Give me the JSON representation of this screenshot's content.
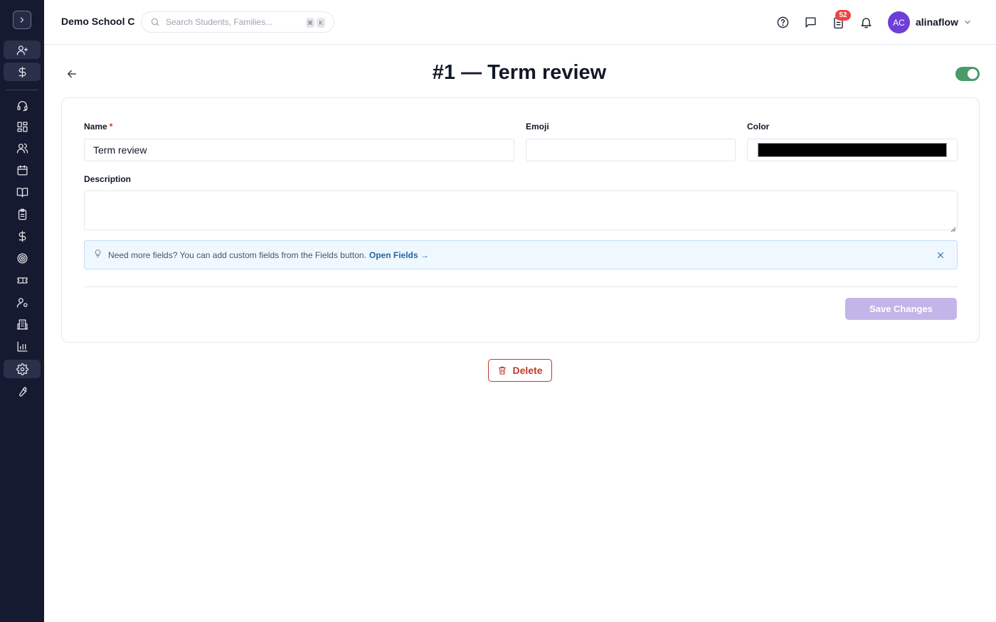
{
  "header": {
    "school_name": "Demo School C",
    "search_placeholder": "Search Students, Families...",
    "shortcut_keys": [
      "⌘",
      "K"
    ],
    "notification_count": "52",
    "user": {
      "initials": "AC",
      "name": "alinaflow",
      "avatar_color": "#6d3fd6"
    }
  },
  "sidebar": {
    "items": [
      {
        "icon": "user-plus-icon"
      },
      {
        "icon": "dollar-icon"
      },
      {
        "icon": "headset-icon"
      },
      {
        "icon": "dashboard-icon"
      },
      {
        "icon": "users-icon"
      },
      {
        "icon": "calendar-icon"
      },
      {
        "icon": "book-open-icon"
      },
      {
        "icon": "clipboard-icon"
      },
      {
        "icon": "dollar-icon"
      },
      {
        "icon": "target-icon"
      },
      {
        "icon": "ticket-icon"
      },
      {
        "icon": "user-cog-icon"
      },
      {
        "icon": "building-icon"
      },
      {
        "icon": "bar-chart-icon"
      },
      {
        "icon": "settings-icon",
        "active": true
      },
      {
        "icon": "wrench-icon"
      }
    ]
  },
  "page": {
    "title": "#1 — Term review",
    "enabled": true,
    "toggle_color": "#4a9a6a"
  },
  "form": {
    "name_label": "Name",
    "required_mark": "*",
    "name_value": "Term review",
    "emoji_label": "Emoji",
    "emoji_value": "",
    "color_label": "Color",
    "color_value": "#000000",
    "description_label": "Description",
    "description_value": "",
    "info_text": "Need more fields? You can add custom fields from the Fields button.",
    "info_link": "Open Fields →",
    "save_label": "Save Changes"
  },
  "delete_label": "Delete"
}
